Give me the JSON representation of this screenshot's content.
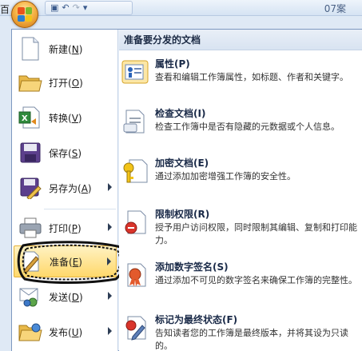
{
  "titlebar": {
    "left_char": "百",
    "title": "07案"
  },
  "qat": {
    "undo": "↶",
    "redo": "↷",
    "dropdown": "▾"
  },
  "commands": [
    {
      "label": "新建",
      "key": "N",
      "icon": "new-document-icon",
      "submenu": false
    },
    {
      "label": "打开",
      "key": "O",
      "icon": "open-folder-icon",
      "submenu": false
    },
    {
      "label": "转换",
      "key": "V",
      "icon": "convert-excel-icon",
      "submenu": false
    },
    {
      "label": "保存",
      "key": "S",
      "icon": "save-disk-icon",
      "submenu": false
    },
    {
      "label": "另存为",
      "key": "A",
      "icon": "save-as-icon",
      "submenu": true
    },
    {
      "label": "打印",
      "key": "P",
      "icon": "printer-icon",
      "submenu": true
    },
    {
      "label": "准备",
      "key": "E",
      "icon": "prepare-pen-icon",
      "submenu": true,
      "active": true
    },
    {
      "label": "发送",
      "key": "D",
      "icon": "send-mail-icon",
      "submenu": true
    },
    {
      "label": "发布",
      "key": "U",
      "icon": "publish-folder-icon",
      "submenu": true
    }
  ],
  "submenu": {
    "header": "准备要分发的文档",
    "items": [
      {
        "title": "属性(P)",
        "desc": "查看和编辑工作簿属性，如标题、作者和关键字。",
        "icon": "properties-icon"
      },
      {
        "title": "检查文档(I)",
        "desc": "检查工作簿中是否有隐藏的元数据或个人信息。",
        "icon": "inspect-document-icon"
      },
      {
        "title": "加密文档(E)",
        "desc": "通过添加加密增强工作簿的安全性。",
        "icon": "encrypt-key-icon"
      },
      {
        "title": "限制权限(R)",
        "desc": "授予用户访问权限，同时限制其编辑、复制和打印能力。",
        "icon": "restrict-permission-icon"
      },
      {
        "title": "添加数字签名(S)",
        "desc": "通过添加不可见的数字签名来确保工作簿的完整性。",
        "icon": "digital-signature-icon"
      },
      {
        "title": "标记为最终状态(F)",
        "desc": "告知读者您的工作簿是最终版本，并将其设为只读的。",
        "icon": "mark-final-icon"
      }
    ]
  },
  "colors": {
    "accent": "#ffd86b",
    "menu_border": "#7d98c0"
  }
}
